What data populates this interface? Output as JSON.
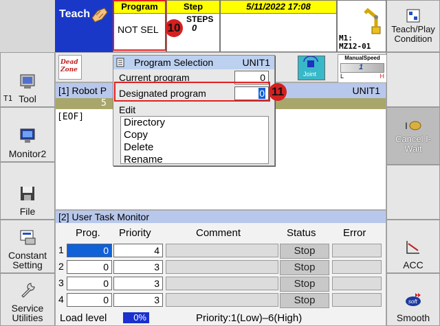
{
  "header": {
    "teach_label": "Teach",
    "program_label": "Program",
    "program_value": "NOT SEL",
    "step_label": "Step",
    "step_value": "STEPS",
    "step_num": "0",
    "datetime": "5/11/2022  17:08",
    "mode_line1": "M1:",
    "mode_line2": "MZ12-01",
    "teachplay_label": "Teach/Play Condition"
  },
  "statusbar": {
    "dead_zone": "Dead Zone",
    "joint_label": "Joint",
    "manual_speed_label": "ManualSpeed",
    "manual_speed_value": "1",
    "scale_l": "L",
    "scale_h": "H"
  },
  "left_sidebar": [
    {
      "label": "Tool",
      "sub": "T1",
      "icon": "tool-icon"
    },
    {
      "label": "Monitor2",
      "icon": "monitor-icon"
    },
    {
      "label": "File",
      "icon": "floppy-disk-icon"
    },
    {
      "label": "Constant Setting",
      "icon": "constant-setting-icon"
    },
    {
      "label": "Service Utilities",
      "icon": "wrench-icon"
    }
  ],
  "right_sidebar": [
    {
      "label": "Cancel I-Wait",
      "icon": "cancel-iwait-icon"
    },
    {
      "label": "ACC",
      "icon": "acc-icon"
    },
    {
      "label": "Smooth",
      "icon": "soft-icon"
    }
  ],
  "robot_panel": {
    "title": "[1] Robot P",
    "unit": "UNIT1",
    "line": "5",
    "eof": "[EOF]"
  },
  "dialog": {
    "title": "Program Selection",
    "unit": "UNIT1",
    "current_label": "Current program",
    "current_value": "0",
    "designated_label": "Designated program",
    "designated_value": "0",
    "edit_label": "Edit",
    "edit_items": [
      "Directory",
      "Copy",
      "Delete",
      "Rename"
    ]
  },
  "task_monitor": {
    "title": "[2] User Task Monitor",
    "columns": [
      "Prog.",
      "Priority",
      "Comment",
      "Status",
      "Error"
    ],
    "rows": [
      {
        "num": "1",
        "prog": "0",
        "priority": "4",
        "status": "Stop"
      },
      {
        "num": "2",
        "prog": "0",
        "priority": "3",
        "status": "Stop"
      },
      {
        "num": "3",
        "prog": "0",
        "priority": "3",
        "status": "Stop"
      },
      {
        "num": "4",
        "prog": "0",
        "priority": "3",
        "status": "Stop"
      }
    ],
    "load_level_label": "Load level",
    "load_level_value": "0%",
    "priority_note": "Priority:1(Low)–6(High)"
  },
  "annotations": {
    "badge10": "10",
    "badge11": "11"
  },
  "colors": {
    "accent_blue": "#1060d8",
    "header_yellow": "#ffff00",
    "annotation_red": "#e02020",
    "bar_olive": "#a8a66a"
  }
}
